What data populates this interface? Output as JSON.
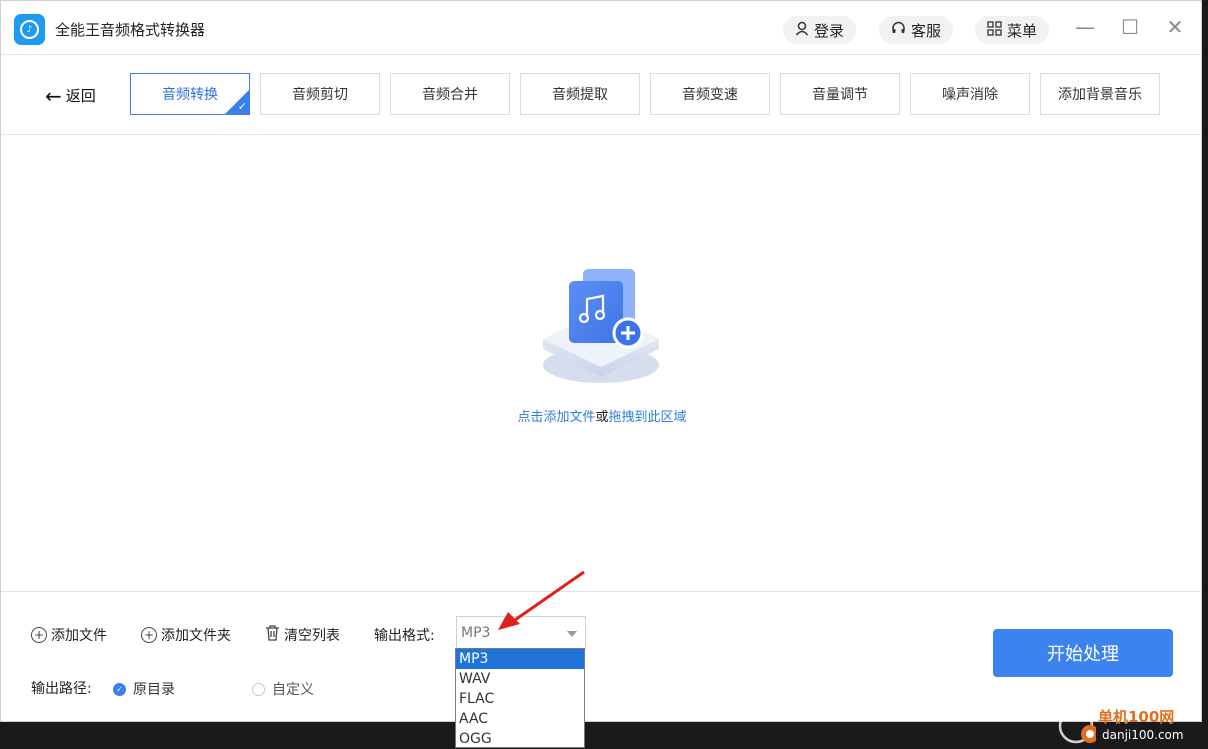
{
  "app": {
    "title": "全能王音频格式转换器",
    "login_label": "登录",
    "service_label": "客服",
    "menu_label": "菜单"
  },
  "nav": {
    "back_label": "返回",
    "tabs": [
      {
        "label": "音频转换",
        "active": true
      },
      {
        "label": "音频剪切",
        "active": false
      },
      {
        "label": "音频合并",
        "active": false
      },
      {
        "label": "音频提取",
        "active": false
      },
      {
        "label": "音频变速",
        "active": false
      },
      {
        "label": "音量调节",
        "active": false
      },
      {
        "label": "噪声消除",
        "active": false
      },
      {
        "label": "添加背景音乐",
        "active": false
      }
    ]
  },
  "dropzone": {
    "text_add": "点击添加文件",
    "text_or": "或",
    "text_drag": "拖拽到此区域"
  },
  "bottom": {
    "add_file": "添加文件",
    "add_folder": "添加文件夹",
    "clear_list": "清空列表",
    "format_label": "输出格式:",
    "format_value": "MP3",
    "format_options": [
      "MP3",
      "WAV",
      "FLAC",
      "AAC",
      "OGG"
    ],
    "path_label": "输出路径:",
    "path_original": "原目录",
    "path_custom": "自定义",
    "start_label": "开始处理"
  },
  "watermark": {
    "cn": "单机100网",
    "url": "danji100.com"
  },
  "colors": {
    "accent": "#3a7ff0",
    "link": "#2f7de1",
    "selected_option": "#1f73db",
    "annotation_arrow": "#e0201c"
  }
}
